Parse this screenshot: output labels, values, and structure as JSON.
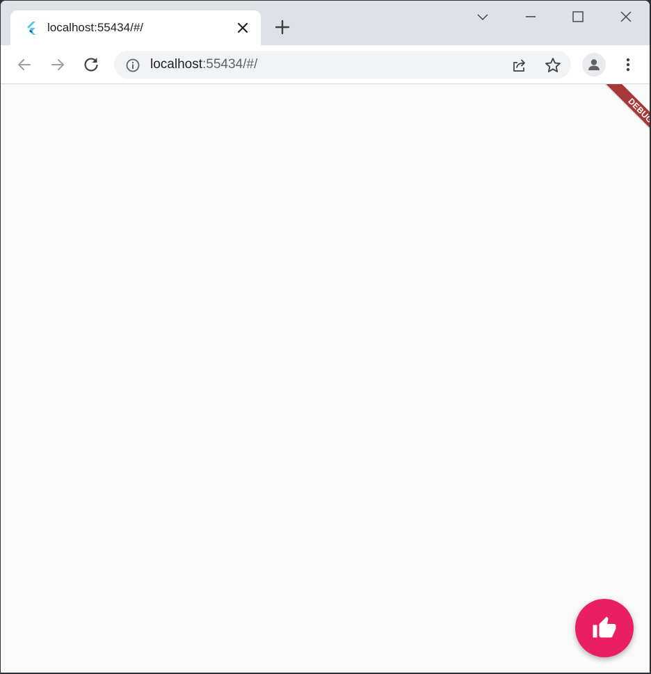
{
  "browser": {
    "tab": {
      "title": "localhost:55434/#/",
      "favicon": "flutter-logo-icon"
    },
    "address": {
      "host": "localhost",
      "rest": ":55434/#/"
    },
    "icons": {
      "back": "arrow-left-icon",
      "forward": "arrow-right-icon",
      "reload": "reload-icon",
      "info": "info-icon",
      "share": "share-icon",
      "bookmark": "star-icon",
      "profile": "avatar-icon",
      "menu": "kebab-menu-icon"
    }
  },
  "app": {
    "debug_banner": "DEBUG",
    "fab": {
      "icon": "thumb-up-icon",
      "color": "#e91e63"
    }
  }
}
